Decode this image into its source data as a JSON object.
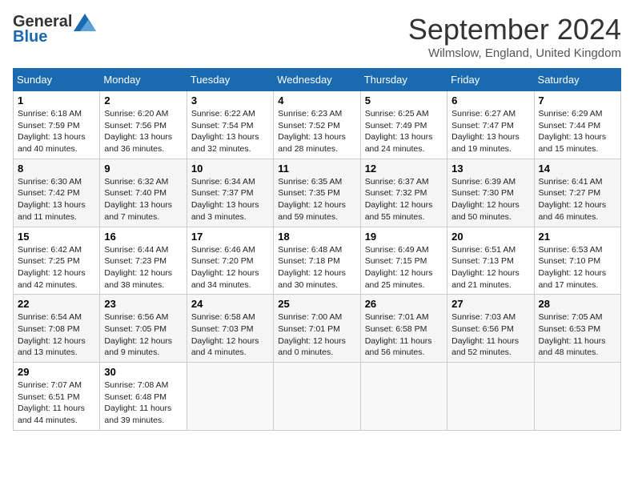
{
  "logo": {
    "general": "General",
    "blue": "Blue"
  },
  "title": "September 2024",
  "location": "Wilmslow, England, United Kingdom",
  "weekdays": [
    "Sunday",
    "Monday",
    "Tuesday",
    "Wednesday",
    "Thursday",
    "Friday",
    "Saturday"
  ],
  "weeks": [
    [
      {
        "day": "1",
        "sunrise": "6:18 AM",
        "sunset": "7:59 PM",
        "daylight": "13 hours and 40 minutes."
      },
      {
        "day": "2",
        "sunrise": "6:20 AM",
        "sunset": "7:56 PM",
        "daylight": "13 hours and 36 minutes."
      },
      {
        "day": "3",
        "sunrise": "6:22 AM",
        "sunset": "7:54 PM",
        "daylight": "13 hours and 32 minutes."
      },
      {
        "day": "4",
        "sunrise": "6:23 AM",
        "sunset": "7:52 PM",
        "daylight": "13 hours and 28 minutes."
      },
      {
        "day": "5",
        "sunrise": "6:25 AM",
        "sunset": "7:49 PM",
        "daylight": "13 hours and 24 minutes."
      },
      {
        "day": "6",
        "sunrise": "6:27 AM",
        "sunset": "7:47 PM",
        "daylight": "13 hours and 19 minutes."
      },
      {
        "day": "7",
        "sunrise": "6:29 AM",
        "sunset": "7:44 PM",
        "daylight": "13 hours and 15 minutes."
      }
    ],
    [
      {
        "day": "8",
        "sunrise": "6:30 AM",
        "sunset": "7:42 PM",
        "daylight": "13 hours and 11 minutes."
      },
      {
        "day": "9",
        "sunrise": "6:32 AM",
        "sunset": "7:40 PM",
        "daylight": "13 hours and 7 minutes."
      },
      {
        "day": "10",
        "sunrise": "6:34 AM",
        "sunset": "7:37 PM",
        "daylight": "13 hours and 3 minutes."
      },
      {
        "day": "11",
        "sunrise": "6:35 AM",
        "sunset": "7:35 PM",
        "daylight": "12 hours and 59 minutes."
      },
      {
        "day": "12",
        "sunrise": "6:37 AM",
        "sunset": "7:32 PM",
        "daylight": "12 hours and 55 minutes."
      },
      {
        "day": "13",
        "sunrise": "6:39 AM",
        "sunset": "7:30 PM",
        "daylight": "12 hours and 50 minutes."
      },
      {
        "day": "14",
        "sunrise": "6:41 AM",
        "sunset": "7:27 PM",
        "daylight": "12 hours and 46 minutes."
      }
    ],
    [
      {
        "day": "15",
        "sunrise": "6:42 AM",
        "sunset": "7:25 PM",
        "daylight": "12 hours and 42 minutes."
      },
      {
        "day": "16",
        "sunrise": "6:44 AM",
        "sunset": "7:23 PM",
        "daylight": "12 hours and 38 minutes."
      },
      {
        "day": "17",
        "sunrise": "6:46 AM",
        "sunset": "7:20 PM",
        "daylight": "12 hours and 34 minutes."
      },
      {
        "day": "18",
        "sunrise": "6:48 AM",
        "sunset": "7:18 PM",
        "daylight": "12 hours and 30 minutes."
      },
      {
        "day": "19",
        "sunrise": "6:49 AM",
        "sunset": "7:15 PM",
        "daylight": "12 hours and 25 minutes."
      },
      {
        "day": "20",
        "sunrise": "6:51 AM",
        "sunset": "7:13 PM",
        "daylight": "12 hours and 21 minutes."
      },
      {
        "day": "21",
        "sunrise": "6:53 AM",
        "sunset": "7:10 PM",
        "daylight": "12 hours and 17 minutes."
      }
    ],
    [
      {
        "day": "22",
        "sunrise": "6:54 AM",
        "sunset": "7:08 PM",
        "daylight": "12 hours and 13 minutes."
      },
      {
        "day": "23",
        "sunrise": "6:56 AM",
        "sunset": "7:05 PM",
        "daylight": "12 hours and 9 minutes."
      },
      {
        "day": "24",
        "sunrise": "6:58 AM",
        "sunset": "7:03 PM",
        "daylight": "12 hours and 4 minutes."
      },
      {
        "day": "25",
        "sunrise": "7:00 AM",
        "sunset": "7:01 PM",
        "daylight": "12 hours and 0 minutes."
      },
      {
        "day": "26",
        "sunrise": "7:01 AM",
        "sunset": "6:58 PM",
        "daylight": "11 hours and 56 minutes."
      },
      {
        "day": "27",
        "sunrise": "7:03 AM",
        "sunset": "6:56 PM",
        "daylight": "11 hours and 52 minutes."
      },
      {
        "day": "28",
        "sunrise": "7:05 AM",
        "sunset": "6:53 PM",
        "daylight": "11 hours and 48 minutes."
      }
    ],
    [
      {
        "day": "29",
        "sunrise": "7:07 AM",
        "sunset": "6:51 PM",
        "daylight": "11 hours and 44 minutes."
      },
      {
        "day": "30",
        "sunrise": "7:08 AM",
        "sunset": "6:48 PM",
        "daylight": "11 hours and 39 minutes."
      },
      null,
      null,
      null,
      null,
      null
    ]
  ]
}
